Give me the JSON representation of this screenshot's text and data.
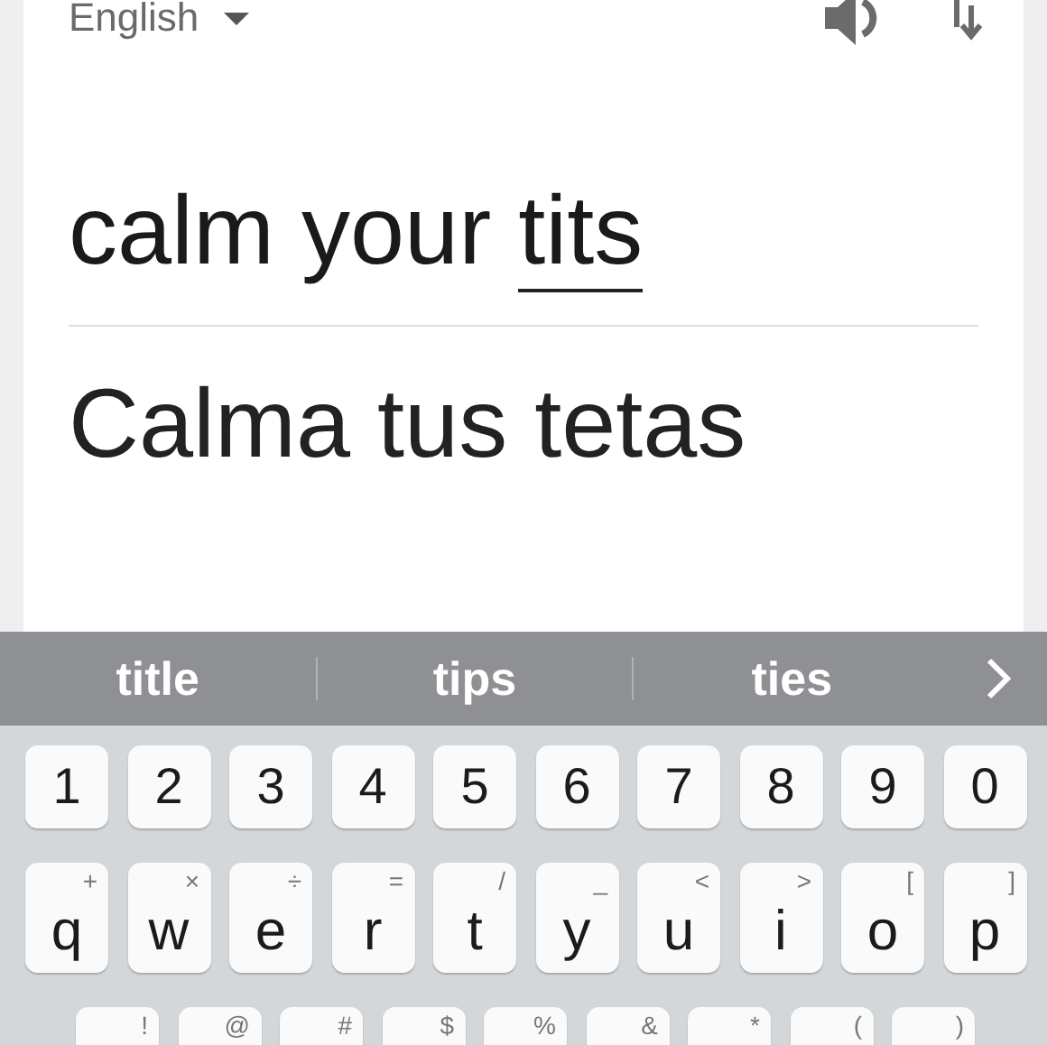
{
  "source_language": {
    "label": "English"
  },
  "input": {
    "text": "calm your",
    "composing_word": "tits"
  },
  "translation": {
    "text": "Calma tus tetas"
  },
  "suggestions": [
    "title",
    "tips",
    "ties"
  ],
  "keyboard": {
    "rows": [
      [
        {
          "label": "1"
        },
        {
          "label": "2"
        },
        {
          "label": "3"
        },
        {
          "label": "4"
        },
        {
          "label": "5"
        },
        {
          "label": "6"
        },
        {
          "label": "7"
        },
        {
          "label": "8"
        },
        {
          "label": "9"
        },
        {
          "label": "0"
        }
      ],
      [
        {
          "label": "q",
          "hint": "+"
        },
        {
          "label": "w",
          "hint": "×"
        },
        {
          "label": "e",
          "hint": "÷"
        },
        {
          "label": "r",
          "hint": "="
        },
        {
          "label": "t",
          "hint": "/"
        },
        {
          "label": "y",
          "hint": "_"
        },
        {
          "label": "u",
          "hint": "<"
        },
        {
          "label": "i",
          "hint": ">"
        },
        {
          "label": "o",
          "hint": "["
        },
        {
          "label": "p",
          "hint": "]"
        }
      ],
      [
        {
          "hint": "!"
        },
        {
          "hint": "@"
        },
        {
          "hint": "#"
        },
        {
          "hint": "$"
        },
        {
          "hint": "%"
        },
        {
          "hint": "&"
        },
        {
          "hint": "*"
        },
        {
          "hint": "("
        },
        {
          "hint": ")"
        }
      ]
    ]
  }
}
